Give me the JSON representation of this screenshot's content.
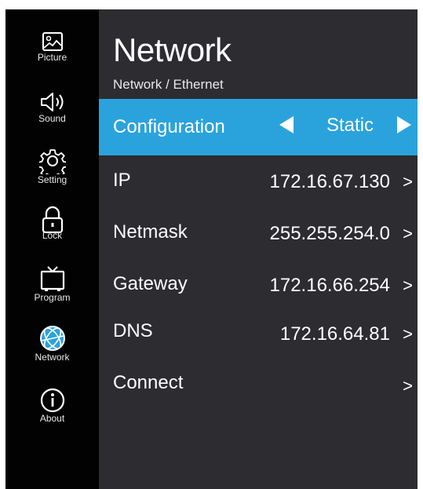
{
  "sidebar": {
    "items": [
      {
        "label": "Picture",
        "icon": "picture-icon"
      },
      {
        "label": "Sound",
        "icon": "speaker-icon"
      },
      {
        "label": "Setting",
        "icon": "gear-icon"
      },
      {
        "label": "Lock",
        "icon": "lock-icon"
      },
      {
        "label": "Program",
        "icon": "tv-icon"
      },
      {
        "label": "Network",
        "icon": "globe-icon"
      },
      {
        "label": "About",
        "icon": "info-icon"
      }
    ],
    "selected": "Network"
  },
  "header": {
    "title": "Network",
    "breadcrumb": "Network / Ethernet"
  },
  "settings": {
    "configuration": {
      "label": "Configuration",
      "value": "Static"
    },
    "ip": {
      "label": "IP",
      "value": "172.16.67.130"
    },
    "netmask": {
      "label": "Netmask",
      "value": "255.255.254.0"
    },
    "gateway": {
      "label": "Gateway",
      "value": "172.16.66.254"
    },
    "dns": {
      "label": "DNS",
      "value": "172.16.64.81"
    },
    "connect": {
      "label": "Connect"
    },
    "arrow": ">"
  },
  "colors": {
    "highlight": "#2aa3dc",
    "panel": "#2c2c31",
    "sidebar": "#020203",
    "network_icon": "#2aa3dc"
  }
}
